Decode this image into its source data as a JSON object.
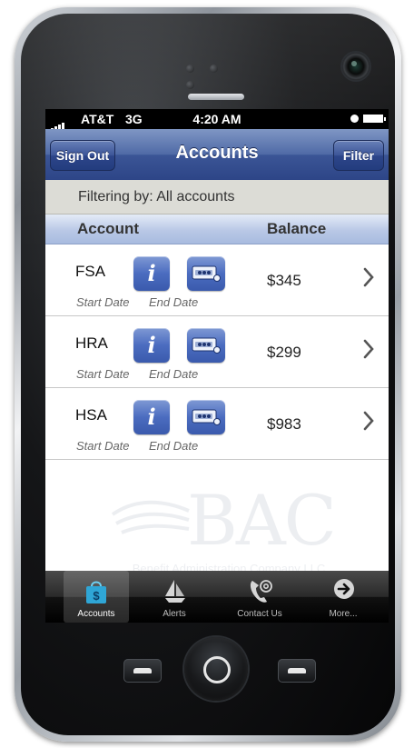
{
  "status_bar": {
    "carrier": "AT&T",
    "network": "3G",
    "time": "4:20 AM"
  },
  "nav_bar": {
    "title": "Accounts",
    "left_button": "Sign Out",
    "right_button": "Filter"
  },
  "filter": {
    "text": "Filtering by: All accounts"
  },
  "columns": {
    "account": "Account",
    "balance": "Balance"
  },
  "accounts": [
    {
      "name": "FSA",
      "start_label": "Start Date",
      "end_label": "End Date",
      "balance": "$345"
    },
    {
      "name": "HRA",
      "start_label": "Start Date",
      "end_label": "End Date",
      "balance": "$299"
    },
    {
      "name": "HSA",
      "start_label": "Start Date",
      "end_label": "End Date",
      "balance": "$983"
    }
  ],
  "watermark": {
    "letters": "BAC",
    "tagline": "Benefit Administration Company LLC"
  },
  "tab_bar": {
    "tabs": [
      {
        "label": "Accounts",
        "icon": "shopping-bag-icon",
        "active": true
      },
      {
        "label": "Alerts",
        "icon": "sailboat-icon",
        "active": false
      },
      {
        "label": "Contact Us",
        "icon": "phone-at-icon",
        "active": false
      },
      {
        "label": "More...",
        "icon": "arrow-circle-icon",
        "active": false
      }
    ]
  },
  "colors": {
    "nav_blue": "#3b5596",
    "button_blue": "#4b6cc0",
    "filter_bg": "#dcdcd6"
  }
}
